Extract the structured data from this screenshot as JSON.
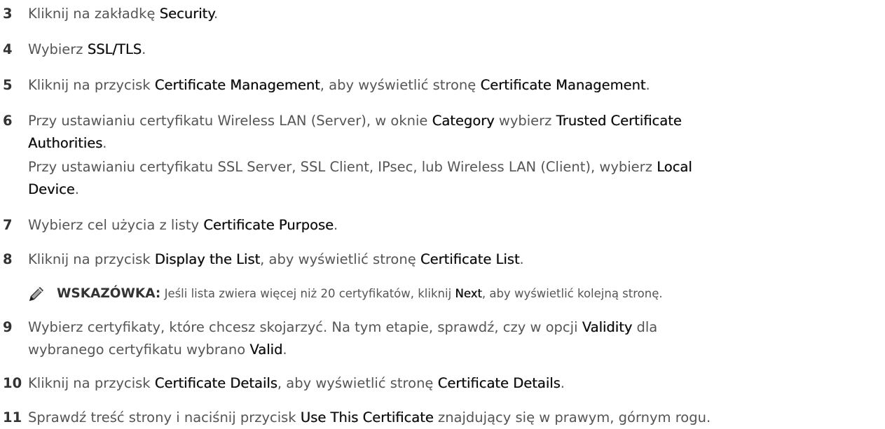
{
  "steps": [
    {
      "number": "3",
      "lines": [
        [
          {
            "t": "Kliknij na zakładkę "
          },
          {
            "t": "Security",
            "b": true
          },
          {
            "t": "."
          }
        ]
      ]
    },
    {
      "number": "4",
      "lines": [
        [
          {
            "t": "Wybierz "
          },
          {
            "t": "SSL/TLS",
            "b": true
          },
          {
            "t": "."
          }
        ]
      ]
    },
    {
      "number": "5",
      "lines": [
        [
          {
            "t": "Kliknij na przycisk "
          },
          {
            "t": "Certificate Management",
            "b": true
          },
          {
            "t": ", aby wyświetlić stronę "
          },
          {
            "t": "Certificate Management",
            "b": true
          },
          {
            "t": "."
          }
        ]
      ]
    },
    {
      "number": "6",
      "lines": [
        [
          {
            "t": "Przy ustawianiu certyfikatu Wireless LAN (Server), w oknie "
          },
          {
            "t": "Category",
            "b": true
          },
          {
            "t": " wybierz "
          },
          {
            "t": "Trusted Certificate",
            "b": true
          }
        ],
        [
          {
            "t": "Authorities",
            "b": true
          },
          {
            "t": "."
          }
        ],
        [
          {
            "t": "Przy ustawianiu certyfikatu SSL Server, SSL Client, IPsec, lub Wireless LAN (Client), wybierz "
          },
          {
            "t": "Local",
            "b": true
          }
        ],
        [
          {
            "t": "Device",
            "b": true
          },
          {
            "t": "."
          }
        ]
      ]
    },
    {
      "number": "7",
      "lines": [
        [
          {
            "t": "Wybierz cel użycia z listy "
          },
          {
            "t": "Certificate Purpose",
            "b": true
          },
          {
            "t": "."
          }
        ]
      ]
    },
    {
      "number": "8",
      "lines": [
        [
          {
            "t": "Kliknij na przycisk "
          },
          {
            "t": "Display the List",
            "b": true
          },
          {
            "t": ", aby wyświetlić stronę "
          },
          {
            "t": "Certificate List",
            "b": true
          },
          {
            "t": "."
          }
        ]
      ]
    },
    {
      "number": "9",
      "lines": [
        [
          {
            "t": "Wybierz certyfikaty, które chcesz skojarzyć. Na tym etapie, sprawdź, czy w opcji "
          },
          {
            "t": "Validity",
            "b": true
          },
          {
            "t": " dla"
          }
        ],
        [
          {
            "t": "wybranego certyfikatu wybrano "
          },
          {
            "t": "Valid",
            "b": true
          },
          {
            "t": "."
          }
        ]
      ]
    },
    {
      "number": "10",
      "lines": [
        [
          {
            "t": "Kliknij na przycisk "
          },
          {
            "t": "Certificate Details",
            "b": true
          },
          {
            "t": ", aby wyświetlić stronę "
          },
          {
            "t": "Certificate Details",
            "b": true
          },
          {
            "t": "."
          }
        ]
      ]
    },
    {
      "number": "11",
      "lines": [
        [
          {
            "t": "Sprawdź treść strony i naciśnij przycisk "
          },
          {
            "t": "Use This Certificate",
            "b": true
          },
          {
            "t": " znajdujący się w prawym, górnym rogu."
          }
        ]
      ]
    }
  ],
  "note": {
    "icon": "pencil-note-icon",
    "label": "WSKAZÓWKA:",
    "segments": [
      {
        "t": " Jeśli lista zwiera więcej niż 20 certyfikatów, kliknij "
      },
      {
        "t": "Next",
        "b": true
      },
      {
        "t": ", aby wyświetlić kolejną stronę."
      }
    ]
  },
  "colors": {
    "body_text": "#555555",
    "emphasis_text": "#111111",
    "step_number": "#333333"
  }
}
